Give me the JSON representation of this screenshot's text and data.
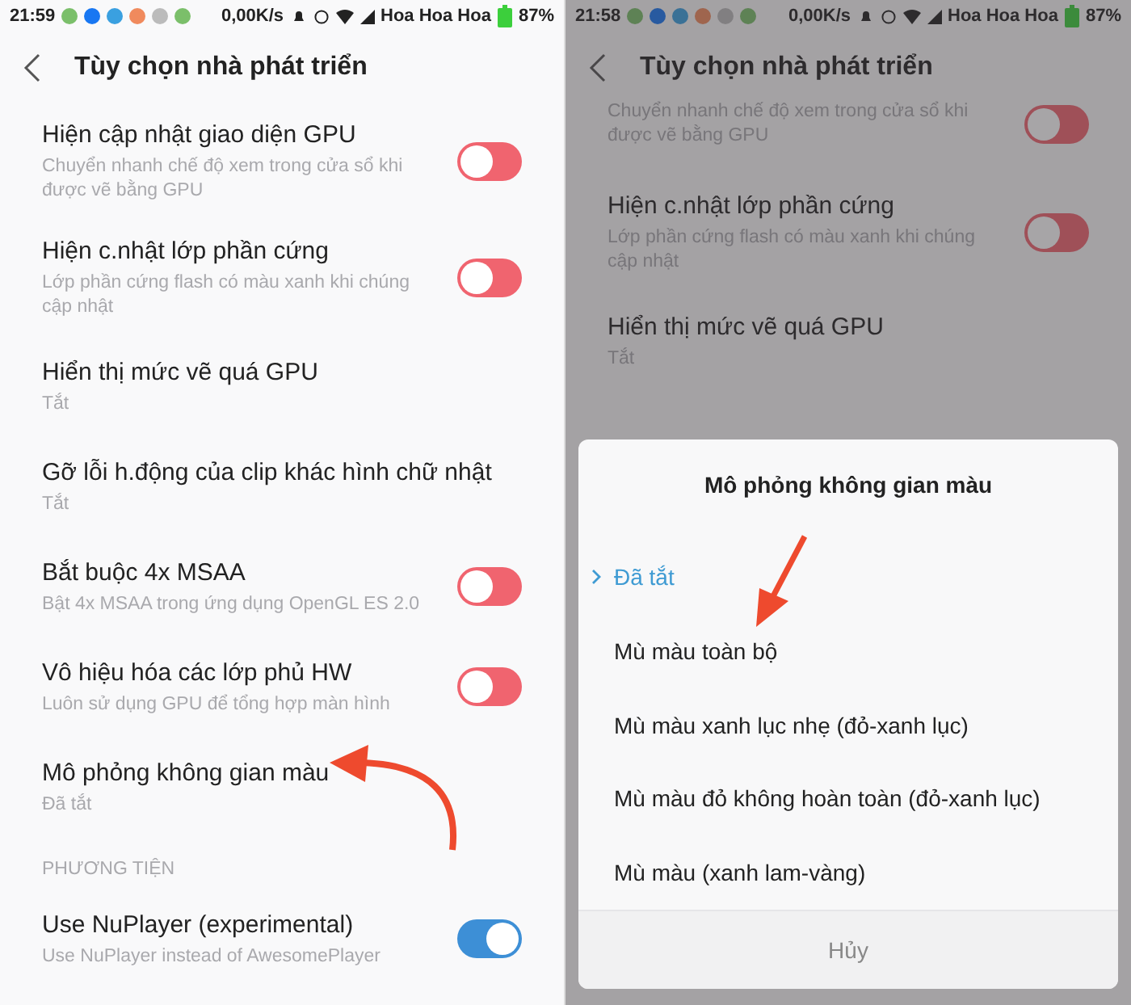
{
  "screens": [
    {
      "dimmed": false,
      "status_bar": {
        "time": "21:59",
        "speed": "0,00K/s",
        "carrier": "Hoa Hoa Hoa",
        "battery": "87%"
      },
      "title": "Tùy chọn nhà phát triển",
      "items": [
        {
          "kind": "toggle",
          "title": "Hiện cập nhật giao diện GPU",
          "subtitle": "Chuyển nhanh chế độ xem trong cửa sổ khi được vẽ bằng GPU",
          "on": false
        },
        {
          "kind": "toggle",
          "title": "Hiện c.nhật lớp phần cứng",
          "subtitle": "Lớp phần cứng flash có màu xanh khi chúng cập nhật",
          "on": false
        },
        {
          "kind": "value",
          "title": "Hiển thị mức vẽ quá GPU",
          "subtitle": "Tắt"
        },
        {
          "kind": "value",
          "title": "Gỡ lỗi h.động của clip khác hình chữ nhật",
          "subtitle": "Tắt"
        },
        {
          "kind": "toggle",
          "title": "Bắt buộc 4x MSAA",
          "subtitle": "Bật 4x MSAA trong ứng dụng OpenGL ES 2.0",
          "on": false
        },
        {
          "kind": "toggle",
          "title": "Vô hiệu hóa các lớp phủ HW",
          "subtitle": "Luôn sử dụng GPU để tổng hợp màn hình",
          "on": false
        },
        {
          "kind": "value",
          "title": "Mô phỏng không gian màu",
          "subtitle": "Đã tắt"
        },
        {
          "kind": "section",
          "title": "PHƯƠNG TIỆN"
        },
        {
          "kind": "toggle",
          "title": "Use NuPlayer (experimental)",
          "subtitle": "Use NuPlayer instead of AwesomePlayer",
          "on": true
        }
      ]
    },
    {
      "dimmed": true,
      "status_bar": {
        "time": "21:58",
        "speed": "0,00K/s",
        "carrier": "Hoa Hoa Hoa",
        "battery": "87%"
      },
      "title": "Tùy chọn nhà phát triển",
      "items": [
        {
          "kind": "toggle",
          "subtitle": "Chuyển nhanh chế độ xem trong cửa sổ khi được vẽ bằng GPU",
          "on": false
        },
        {
          "kind": "toggle",
          "title": "Hiện c.nhật lớp phần cứng",
          "subtitle": "Lớp phần cứng flash có màu xanh khi chúng cập nhật",
          "on": false
        },
        {
          "kind": "value",
          "title": "Hiển thị mức vẽ quá GPU",
          "subtitle": "Tắt"
        }
      ],
      "dialog": {
        "title": "Mô phỏng không gian màu",
        "options": [
          {
            "label": "Đã tắt",
            "selected": true
          },
          {
            "label": "Mù màu toàn bộ",
            "selected": false
          },
          {
            "label": "Mù màu xanh lục nhẹ (đỏ-xanh lục)",
            "selected": false
          },
          {
            "label": "Mù màu đỏ không hoàn toàn (đỏ-xanh lục)",
            "selected": false
          },
          {
            "label": "Mù màu (xanh lam-vàng)",
            "selected": false
          }
        ],
        "cancel": "Hủy"
      }
    }
  ]
}
